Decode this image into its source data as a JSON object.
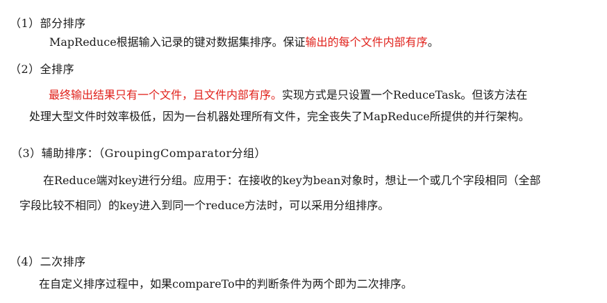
{
  "sections": [
    {
      "heading": "（1）部分排序",
      "lines": [
        {
          "pre": "MapReduce根据输入记录的键对数据集排序。保证",
          "highlight": "输出的每个文件内部有序",
          "post": "。"
        }
      ]
    },
    {
      "heading": "（2）全排序",
      "lines": [
        {
          "pre": "",
          "highlight": "最终输出结果只有一个文件，且文件内部有序。",
          "post": "实现方式是只设置一个ReduceTask。但该方法在"
        },
        {
          "pre": "处理大型文件时效率极低，因为一台机器处理所有文件，完全丧失了MapReduce所提供的并行架构。",
          "highlight": "",
          "post": ""
        }
      ]
    },
    {
      "heading": "（3）辅助排序：（GroupingComparator分组）",
      "lines": [
        {
          "pre": "在Reduce端对key进行分组。应用于：在接收的key为bean对象时，想让一个或几个字段相同（全部",
          "highlight": "",
          "post": ""
        },
        {
          "pre": "字段比较不相同）的key进入到同一个reduce方法时，可以采用分组排序。",
          "highlight": "",
          "post": ""
        }
      ]
    },
    {
      "heading": "（4）二次排序",
      "lines": [
        {
          "pre": "在自定义排序过程中，如果compareTo中的判断条件为两个即为二次排序。",
          "highlight": "",
          "post": ""
        }
      ]
    }
  ],
  "colors": {
    "highlight": "#e0211b",
    "text": "#1a1a1a"
  }
}
